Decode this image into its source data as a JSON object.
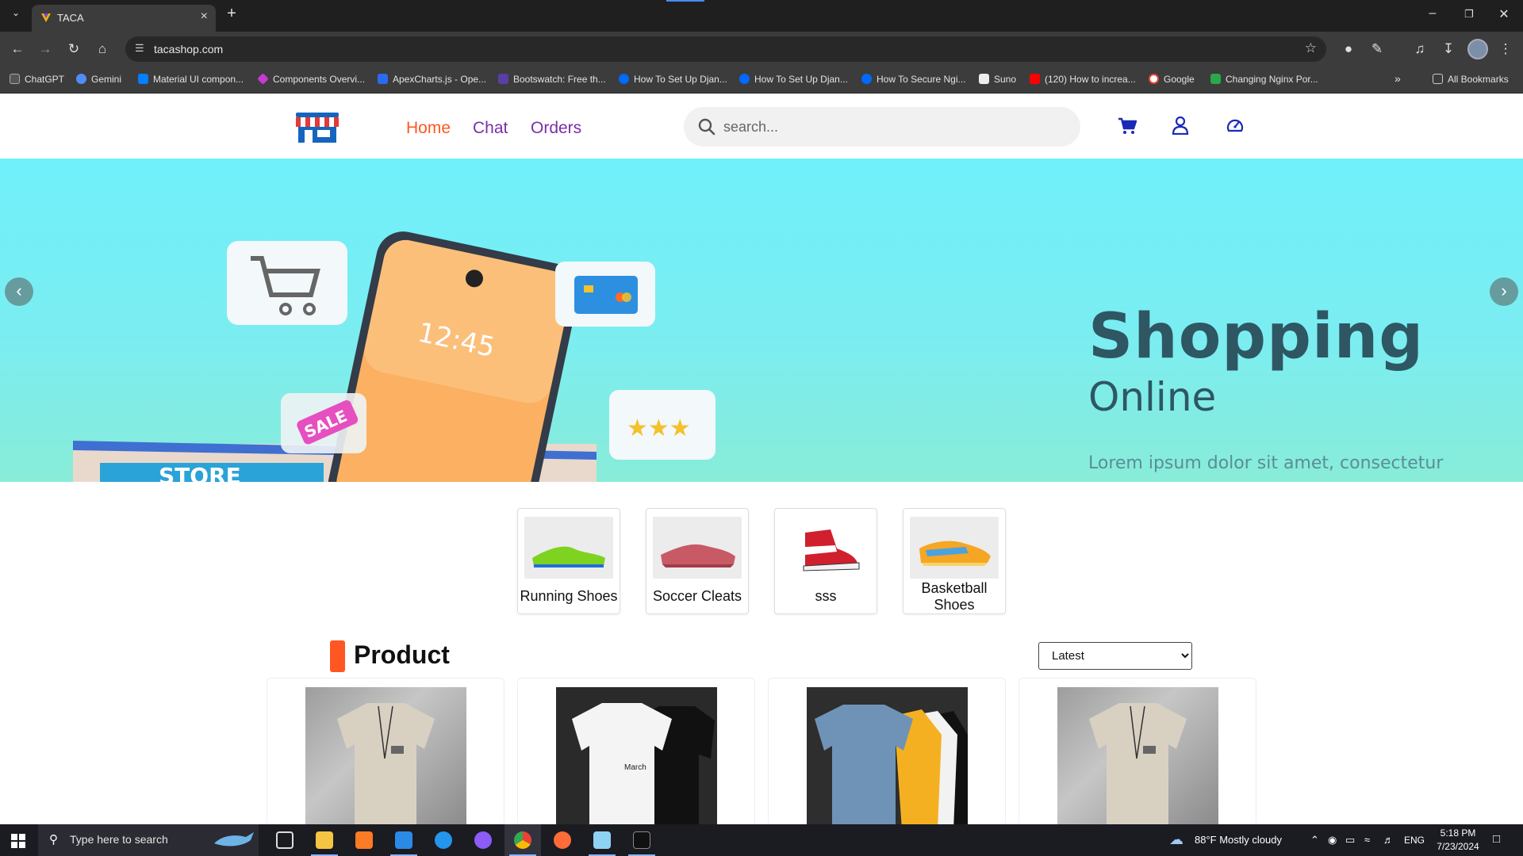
{
  "browser": {
    "tab_title": "TACA",
    "url": "tacashop.com",
    "bookmarks": [
      {
        "label": "ChatGPT",
        "color": "#10a37f"
      },
      {
        "label": "Gemini",
        "color": "#4f8ef7"
      },
      {
        "label": "Material UI compon...",
        "color": "#007fff"
      },
      {
        "label": "Components Overvi...",
        "color": "#c63bd1"
      },
      {
        "label": "ApexCharts.js - Ope...",
        "color": "#2b6bf2"
      },
      {
        "label": "Bootswatch: Free th...",
        "color": "#5a3ea8"
      },
      {
        "label": "How To Set Up Djan...",
        "color": "#0069ff"
      },
      {
        "label": "How To Set Up Djan...",
        "color": "#0069ff"
      },
      {
        "label": "How To Secure Ngi...",
        "color": "#0069ff"
      },
      {
        "label": "Suno",
        "color": "#ffffff"
      },
      {
        "label": "(120) How to increa...",
        "color": "#ff0000"
      },
      {
        "label": "Google",
        "color": "#ffffff"
      },
      {
        "label": "Changing Nginx Por...",
        "color": "#2aa84a"
      }
    ],
    "all_bookmarks": "All Bookmarks"
  },
  "header": {
    "nav": [
      "Home",
      "Chat",
      "Orders"
    ],
    "search_placeholder": "search..."
  },
  "hero": {
    "title": "Shopping",
    "subtitle": "Online",
    "body": "Lorem ipsum dolor sit amet, consectetur",
    "phone_time": "12:45",
    "sale_tag": "SALE",
    "store_sign": "STORE"
  },
  "categories": [
    {
      "label": "Running Shoes"
    },
    {
      "label": "Soccer Cleats"
    },
    {
      "label": "sss"
    },
    {
      "label": "Basketball Shoes"
    }
  ],
  "products": {
    "title": "Product",
    "sort_selected": "Latest",
    "shirt_print": "March"
  },
  "taskbar": {
    "search_placeholder": "Type here to search",
    "weather": "88°F  Mostly cloudy",
    "lang": "ENG",
    "time": "5:18 PM",
    "date": "7/23/2024"
  },
  "colors": {
    "accent": "#ff5722",
    "nav": "#7b2ea8",
    "icons": "#1a2ab8"
  }
}
